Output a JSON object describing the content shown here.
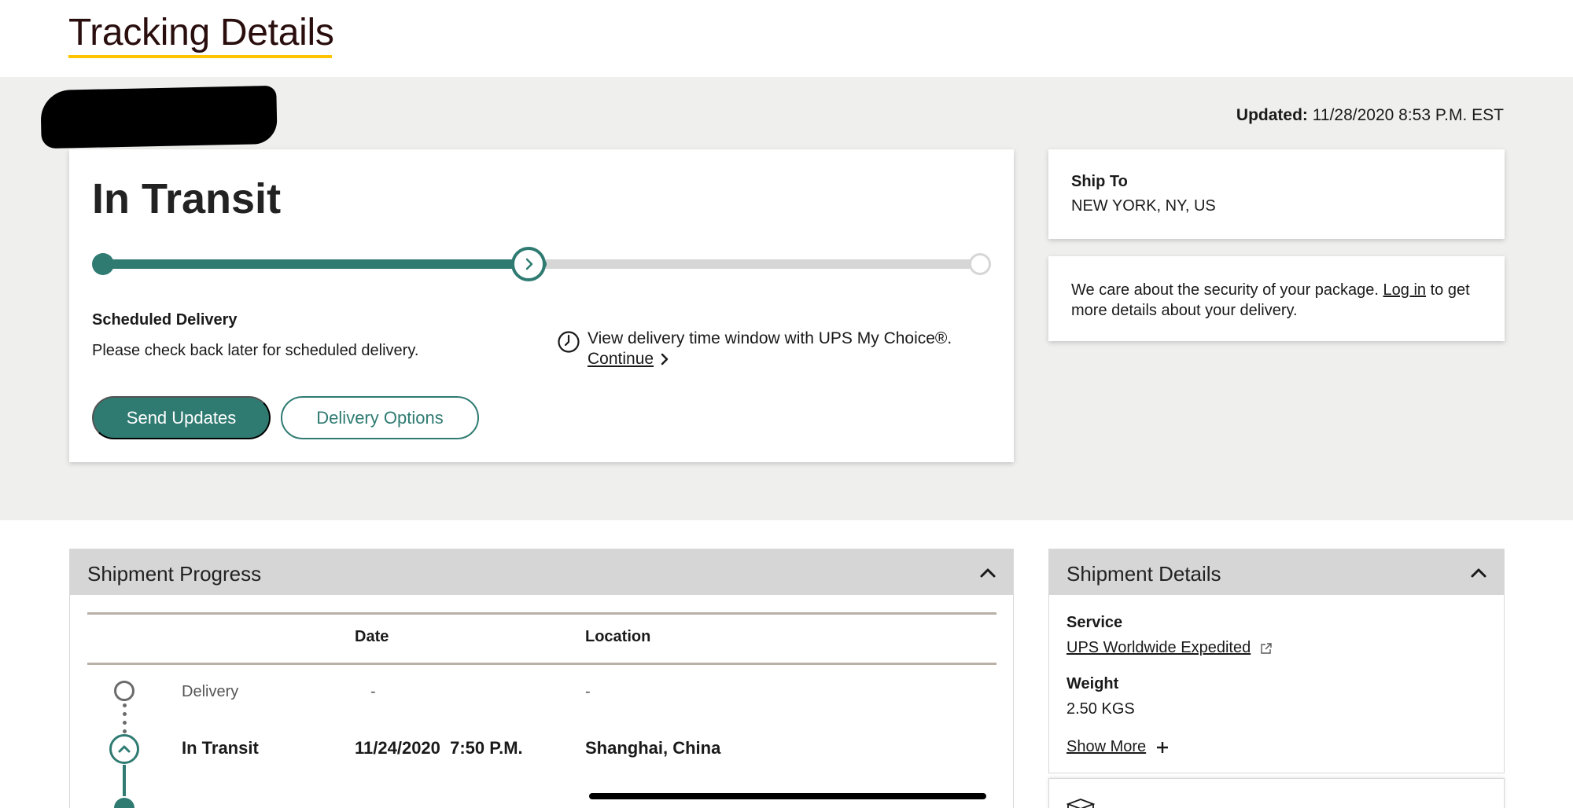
{
  "header": {
    "title": "Tracking Details"
  },
  "updated": {
    "label": "Updated:",
    "value": "11/28/2020 8:53 P.M. EST"
  },
  "status": {
    "title": "In Transit",
    "progress_fraction": 0.5,
    "scheduled_label": "Scheduled Delivery",
    "scheduled_text": "Please check back later for scheduled delivery.",
    "window_text": "View delivery time window with UPS My Choice®.",
    "continue_label": "Continue",
    "send_updates_label": "Send Updates",
    "delivery_options_label": "Delivery Options"
  },
  "ship_to": {
    "label": "Ship To",
    "value": "NEW YORK, NY, US"
  },
  "security": {
    "text_before": "We care about the security of your package.",
    "login_label": "Log in",
    "text_after": "to get more details about your delivery."
  },
  "shipment_progress": {
    "title": "Shipment Progress",
    "columns": {
      "date": "Date",
      "location": "Location"
    },
    "rows": [
      {
        "status": "Delivery",
        "date": "-",
        "location": "-"
      },
      {
        "status": "In Transit",
        "date": "11/24/2020  7:50 P.M.",
        "location": "Shanghai, China"
      }
    ]
  },
  "shipment_details": {
    "title": "Shipment Details",
    "service_label": "Service",
    "service_value": "UPS Worldwide Expedited",
    "weight_label": "Weight",
    "weight_value": "2.50 KGS",
    "show_more_label": "Show More"
  },
  "colors": {
    "accent": "#2f7b72",
    "title_underline": "#ffc400",
    "hero_bg": "#efefee",
    "panel_header_bg": "#d6d6d6"
  },
  "icons": {
    "progress_current": "chevron-right-icon",
    "delivery_window": "clock-icon",
    "continue": "chevron-right-icon",
    "panel_toggle": "chevron-up-icon",
    "service_link": "external-link-icon",
    "show_more": "plus-icon",
    "package": "box-icon"
  }
}
